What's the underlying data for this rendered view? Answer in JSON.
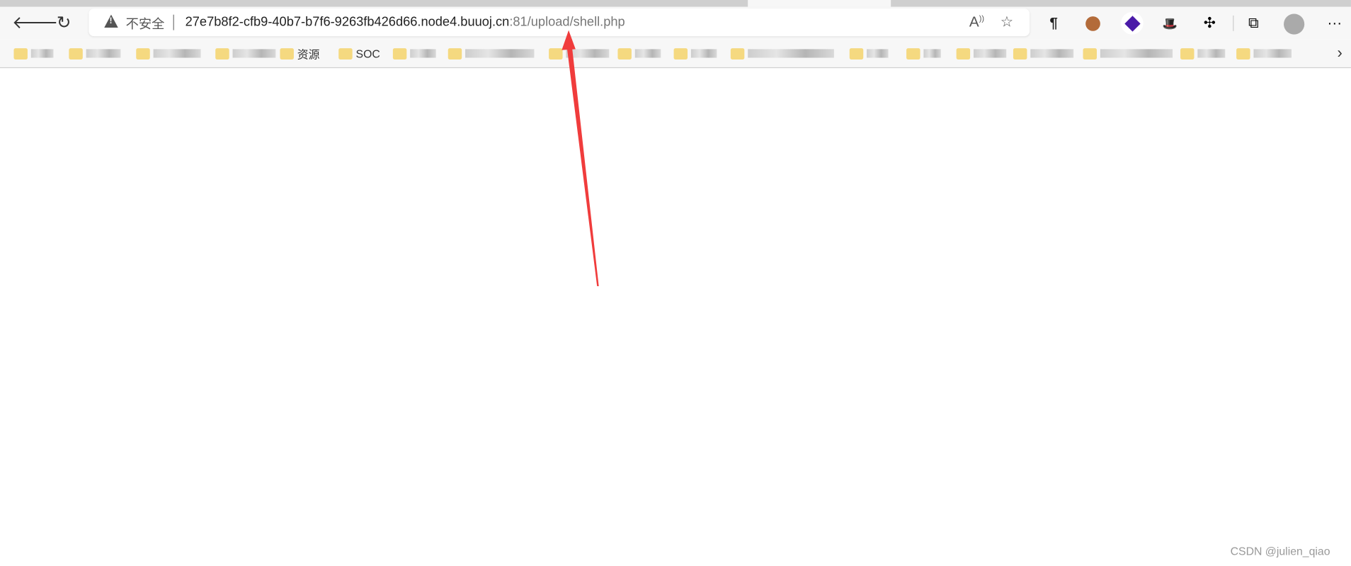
{
  "browser": {
    "address_bar": {
      "security_label": "不安全",
      "url_host": "27e7b8f2-cfb9-40b7-b7f6-9263fb426d66.node4.buuoj.cn",
      "url_rest": ":81/upload/shell.php"
    },
    "nav": {
      "back_icon": "arrow-left-icon",
      "refresh_icon": "refresh-icon"
    },
    "toolbar_icons": [
      "read-aloud-icon",
      "favorite-add-icon",
      "pilcrow-extension-icon",
      "cookie-extension-icon",
      "purple-diamond-extension-icon",
      "hat-extension-icon",
      "extensions-puzzle-icon",
      "collections-icon",
      "profile-avatar-icon",
      "more-icon"
    ],
    "bookmarks": [
      {
        "label": ""
      },
      {
        "label": ""
      },
      {
        "label": ""
      },
      {
        "label": ""
      },
      {
        "label": "资源"
      },
      {
        "label": "SOC"
      },
      {
        "label": ""
      },
      {
        "label": ""
      },
      {
        "label": ""
      },
      {
        "label": ""
      },
      {
        "label": ""
      },
      {
        "label": ""
      },
      {
        "label": ""
      },
      {
        "label": ""
      },
      {
        "label": ""
      },
      {
        "label": ""
      },
      {
        "label": ""
      },
      {
        "label": ""
      },
      {
        "label": ""
      }
    ]
  },
  "annotation": {
    "arrow_color": "#f03c3c"
  },
  "watermark": "CSDN @julien_qiao"
}
